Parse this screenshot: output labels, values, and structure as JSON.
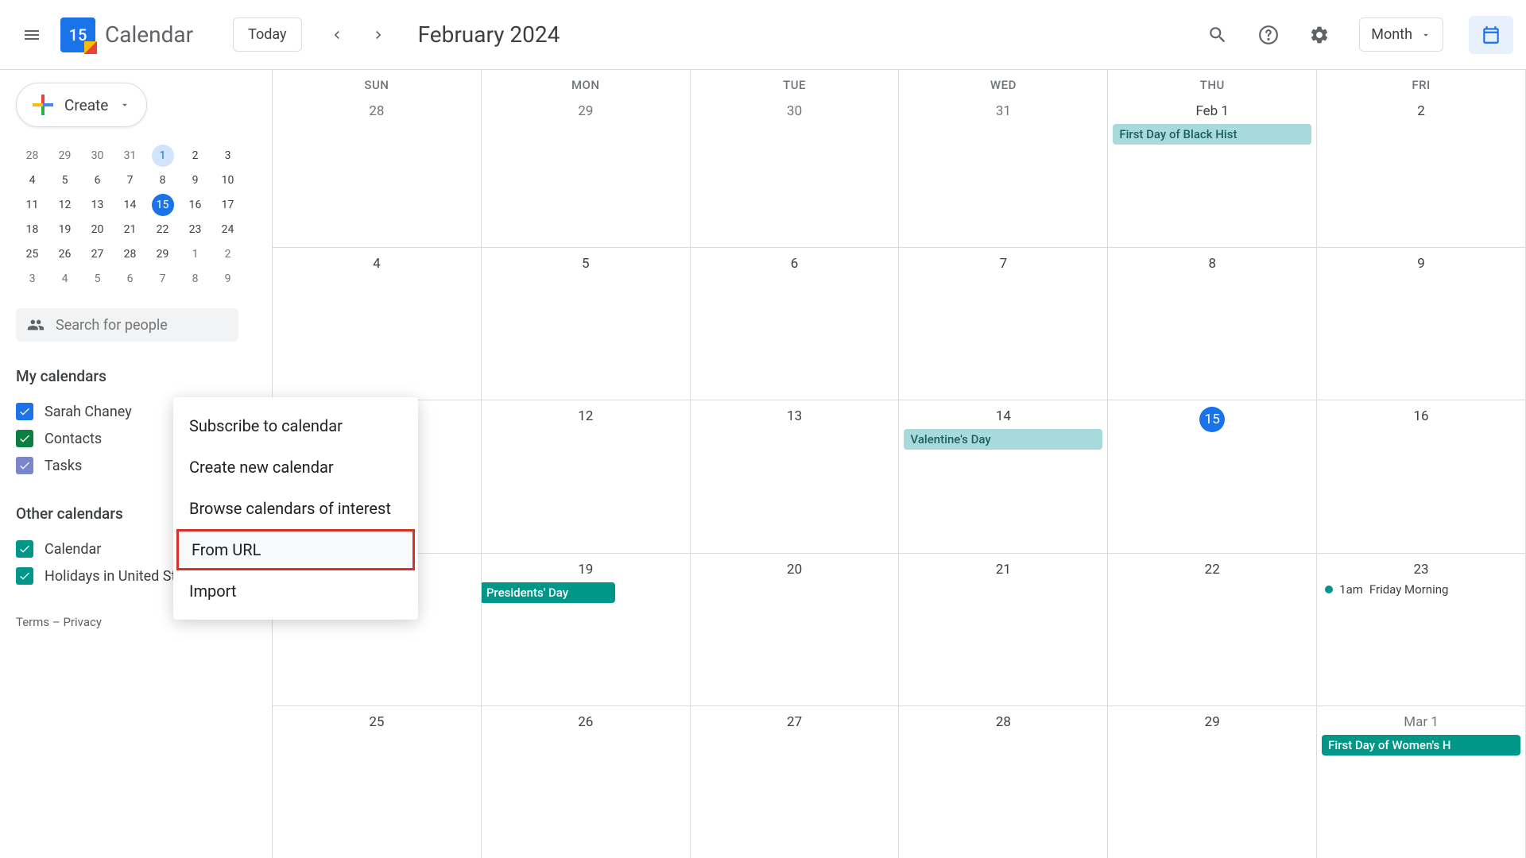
{
  "header": {
    "app_title": "Calendar",
    "logo_date": "15",
    "today_label": "Today",
    "current_view_date": "February 2024",
    "view_selector": "Month"
  },
  "sidebar": {
    "create_label": "Create",
    "search_placeholder": "Search for people",
    "mini_calendar": {
      "rows": [
        [
          "28",
          "29",
          "30",
          "31",
          "1",
          "2",
          "3"
        ],
        [
          "4",
          "5",
          "6",
          "7",
          "8",
          "9",
          "10"
        ],
        [
          "11",
          "12",
          "13",
          "14",
          "15",
          "16",
          "17"
        ],
        [
          "18",
          "19",
          "20",
          "21",
          "22",
          "23",
          "24"
        ],
        [
          "25",
          "26",
          "27",
          "28",
          "29",
          "1",
          "2"
        ],
        [
          "3",
          "4",
          "5",
          "6",
          "7",
          "8",
          "9"
        ]
      ],
      "first_day_idx": [
        0,
        4
      ],
      "today_idx": [
        2,
        4
      ]
    },
    "my_calendars_title": "My calendars",
    "my_calendars": [
      {
        "label": "Sarah Chaney",
        "color": "blue"
      },
      {
        "label": "Contacts",
        "color": "green"
      },
      {
        "label": "Tasks",
        "color": "lightblue"
      }
    ],
    "other_calendars_title": "Other calendars",
    "other_calendars": [
      {
        "label": "Calendar",
        "color": "teal"
      },
      {
        "label": "Holidays in United States",
        "color": "teal"
      }
    ],
    "footer": {
      "terms": "Terms",
      "sep": " – ",
      "privacy": "Privacy"
    }
  },
  "popup": {
    "items": [
      "Subscribe to calendar",
      "Create new calendar",
      "Browse calendars of interest",
      "From URL",
      "Import"
    ],
    "highlighted_index": 3
  },
  "grid": {
    "day_headers": [
      "SUN",
      "MON",
      "TUE",
      "WED",
      "THU",
      "FRI"
    ],
    "weeks": [
      {
        "days": [
          {
            "num": "28",
            "dim": true
          },
          {
            "num": "29",
            "dim": true
          },
          {
            "num": "30",
            "dim": true
          },
          {
            "num": "31",
            "dim": true
          },
          {
            "num": "Feb 1",
            "events": [
              {
                "text": "First Day of Black Hist",
                "style": "light"
              }
            ]
          },
          {
            "num": "2"
          }
        ]
      },
      {
        "days": [
          {
            "num": "4"
          },
          {
            "num": "5"
          },
          {
            "num": "6"
          },
          {
            "num": "7"
          },
          {
            "num": "8"
          },
          {
            "num": "9"
          }
        ]
      },
      {
        "days": [
          {
            "num": ""
          },
          {
            "num": "12"
          },
          {
            "num": "13"
          },
          {
            "num": "14",
            "events": [
              {
                "text": "Valentine's Day",
                "style": "light"
              }
            ]
          },
          {
            "num": "15",
            "today": true
          },
          {
            "num": "16"
          }
        ]
      },
      {
        "days": [
          {
            "num": ""
          },
          {
            "num": "19",
            "events": [
              {
                "text": "Presidents' Day",
                "style": "teal",
                "span": true
              }
            ]
          },
          {
            "num": "20"
          },
          {
            "num": "21"
          },
          {
            "num": "22"
          },
          {
            "num": "23",
            "dot_events": [
              {
                "time": "1am",
                "text": "Friday Morning"
              }
            ]
          }
        ]
      },
      {
        "days": [
          {
            "num": "25"
          },
          {
            "num": "26"
          },
          {
            "num": "27"
          },
          {
            "num": "28"
          },
          {
            "num": "29"
          },
          {
            "num": "Mar 1",
            "dim": true,
            "events": [
              {
                "text": "First Day of Women's H",
                "style": "teal2"
              }
            ]
          }
        ]
      }
    ]
  }
}
